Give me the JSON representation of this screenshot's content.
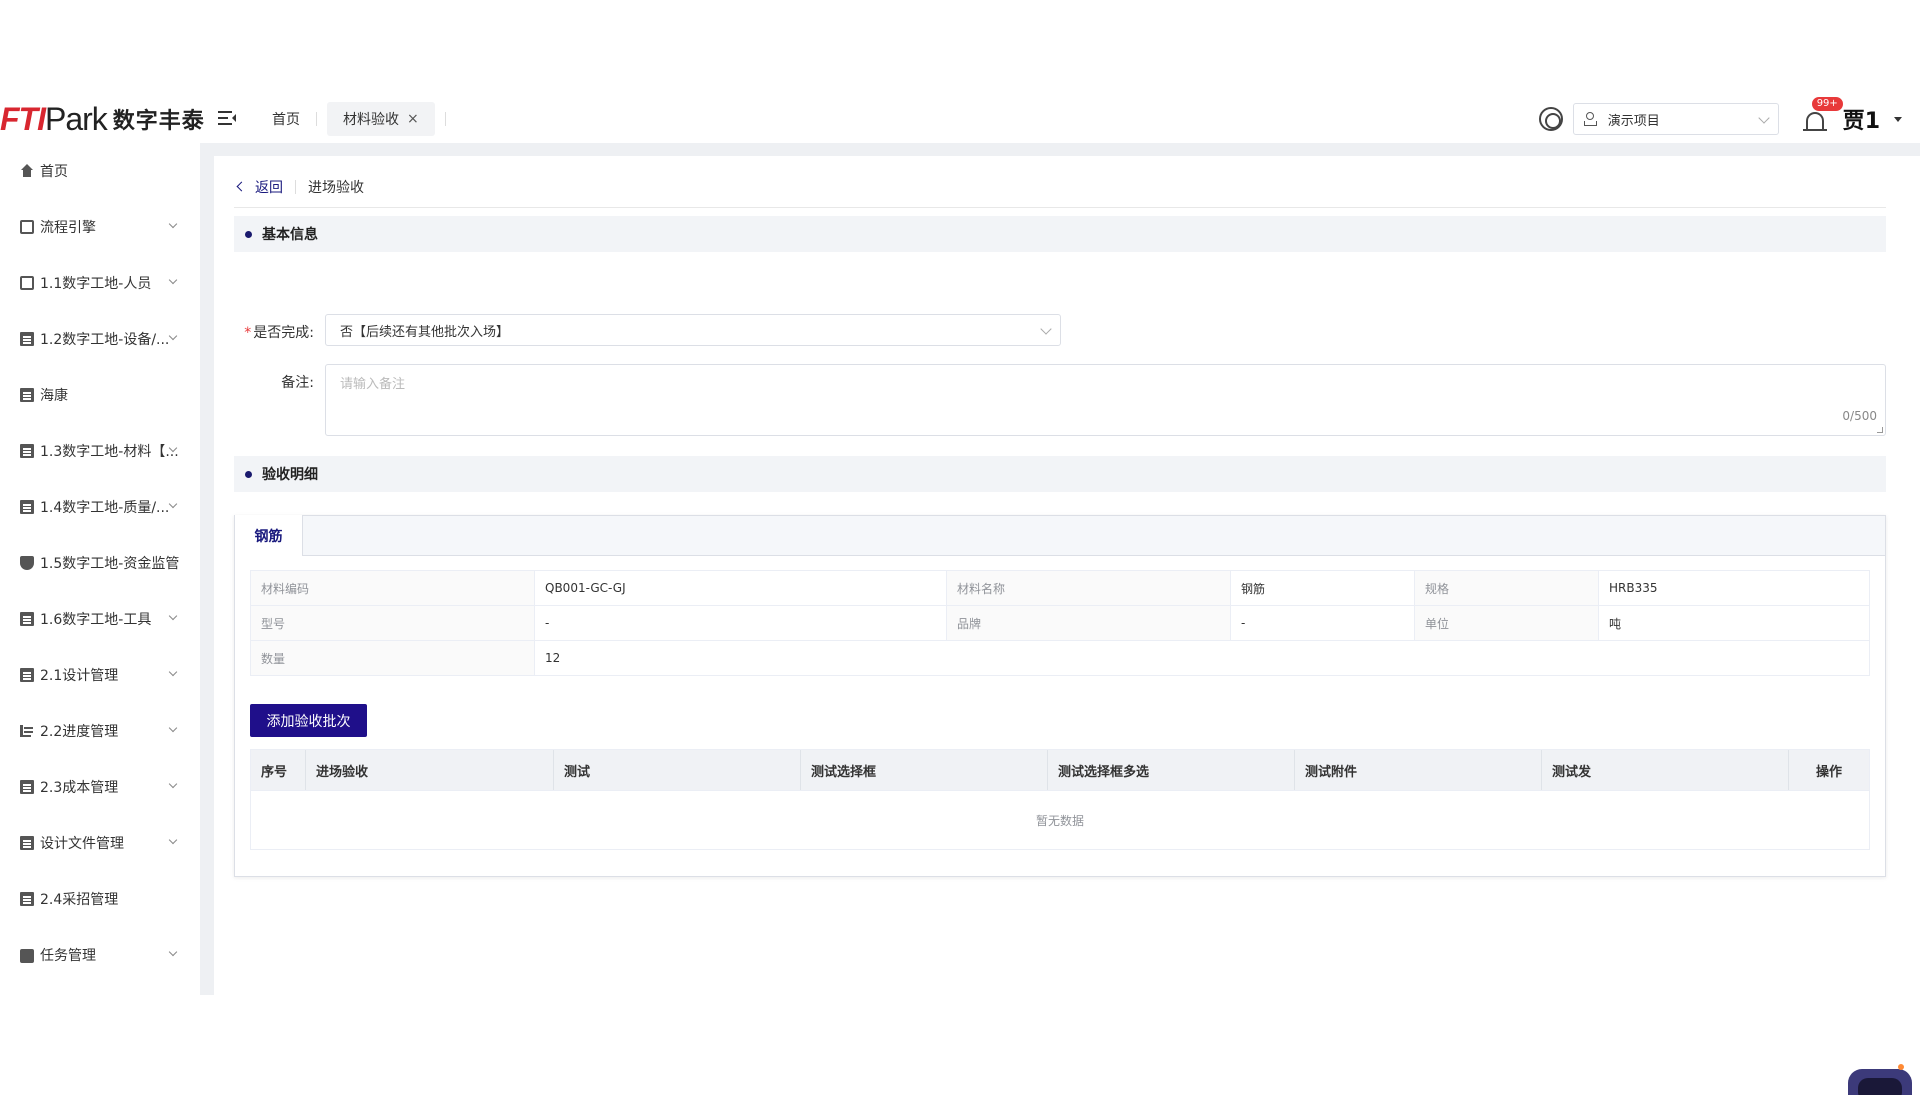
{
  "brand": {
    "logo_fti": "FTI",
    "logo_park": "Park",
    "logo_cn": "数字丰泰"
  },
  "header": {
    "tabs": [
      {
        "label": "首页",
        "active": false
      },
      {
        "label": "材料验收",
        "active": true,
        "close": "×"
      }
    ],
    "project_select": "演示项目",
    "notification_badge": "99+",
    "user_name": "贾1"
  },
  "sidebar": {
    "items": [
      {
        "label": "首页",
        "icon": "home-icon",
        "expandable": false
      },
      {
        "label": "流程引擎",
        "icon": "flow-icon",
        "expandable": true
      },
      {
        "label": "1.1数字工地-人员",
        "icon": "people-icon",
        "expandable": true
      },
      {
        "label": "1.2数字工地-设备/...",
        "icon": "document-icon",
        "expandable": true
      },
      {
        "label": "海康",
        "icon": "document-icon",
        "expandable": false
      },
      {
        "label": "1.3数字工地-材料【...",
        "icon": "document-icon",
        "expandable": true
      },
      {
        "label": "1.4数字工地-质量/...",
        "icon": "document-icon",
        "expandable": true
      },
      {
        "label": "1.5数字工地-资金监管",
        "icon": "shield-icon",
        "expandable": false
      },
      {
        "label": "1.6数字工地-工具",
        "icon": "document-icon",
        "expandable": true
      },
      {
        "label": "2.1设计管理",
        "icon": "document-icon",
        "expandable": true
      },
      {
        "label": "2.2进度管理",
        "icon": "gantt-icon",
        "expandable": true
      },
      {
        "label": "2.3成本管理",
        "icon": "document-icon",
        "expandable": true
      },
      {
        "label": "设计文件管理",
        "icon": "document-icon",
        "expandable": true
      },
      {
        "label": "2.4采招管理",
        "icon": "document-icon",
        "expandable": false
      },
      {
        "label": "任务管理",
        "icon": "briefcase-icon",
        "expandable": true
      }
    ]
  },
  "page": {
    "back_label": "返回",
    "title": "进场验收",
    "section_basic": "基本信息",
    "is_complete_label": "是否完成:",
    "is_complete_value": "否【后续还有其他批次入场】",
    "remark_label": "备注:",
    "remark_placeholder": "请输入备注",
    "remark_count": "0/500",
    "section_detail": "验收明细",
    "material_tab": "钢筋",
    "material_info": {
      "code_label": "材料编码",
      "code": "QB001-GC-GJ",
      "name_label": "材料名称",
      "name": "钢筋",
      "spec_label": "规格",
      "spec": "HRB335",
      "model_label": "型号",
      "model": "-",
      "brand_label": "品牌",
      "brand": "-",
      "unit_label": "单位",
      "unit": "吨",
      "qty_label": "数量",
      "qty": "12"
    },
    "add_batch_button": "添加验收批次",
    "table": {
      "columns": [
        "序号",
        "进场验收",
        "测试",
        "测试选择框",
        "测试选择框多选",
        "测试附件",
        "测试发",
        "操作"
      ],
      "empty_text": "暂无数据"
    }
  },
  "colors": {
    "primary": "#1f0f8a",
    "brand_red": "#d8262f",
    "badge": "#e8393a"
  }
}
